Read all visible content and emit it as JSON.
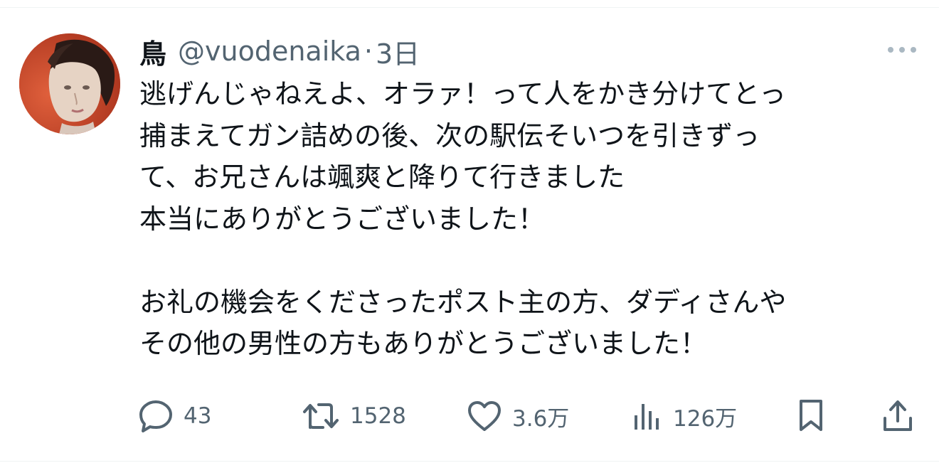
{
  "post": {
    "author": {
      "display_name": "鳥",
      "handle": "@vuodenaika",
      "separator": "·",
      "time": "3日"
    },
    "text_lines": [
      "逃げんじゃねえよ、オラァ！って人をかき分けてとっ",
      "捕まえてガン詰めの後、次の駅伝そいつを引きずっ",
      "て、お兄さんは颯爽と降りて行きました",
      "本当にありがとうございました！",
      "",
      "お礼の機会をくださったポスト主の方、ダディさんや",
      "その他の男性の方もありがとうございました！"
    ],
    "actions": {
      "reply": {
        "icon": "reply-icon",
        "count": "43"
      },
      "repost": {
        "icon": "repost-icon",
        "count": "1528"
      },
      "like": {
        "icon": "heart-icon",
        "count": "3.6万"
      },
      "views": {
        "icon": "views-icon",
        "count": "126万"
      },
      "bookmark": {
        "icon": "bookmark-icon"
      },
      "share": {
        "icon": "share-icon"
      }
    },
    "more_icon": "more-horizontal-icon"
  },
  "colors": {
    "text_primary": "#0f1419",
    "text_secondary": "#536471",
    "divider": "#eff3f4"
  }
}
